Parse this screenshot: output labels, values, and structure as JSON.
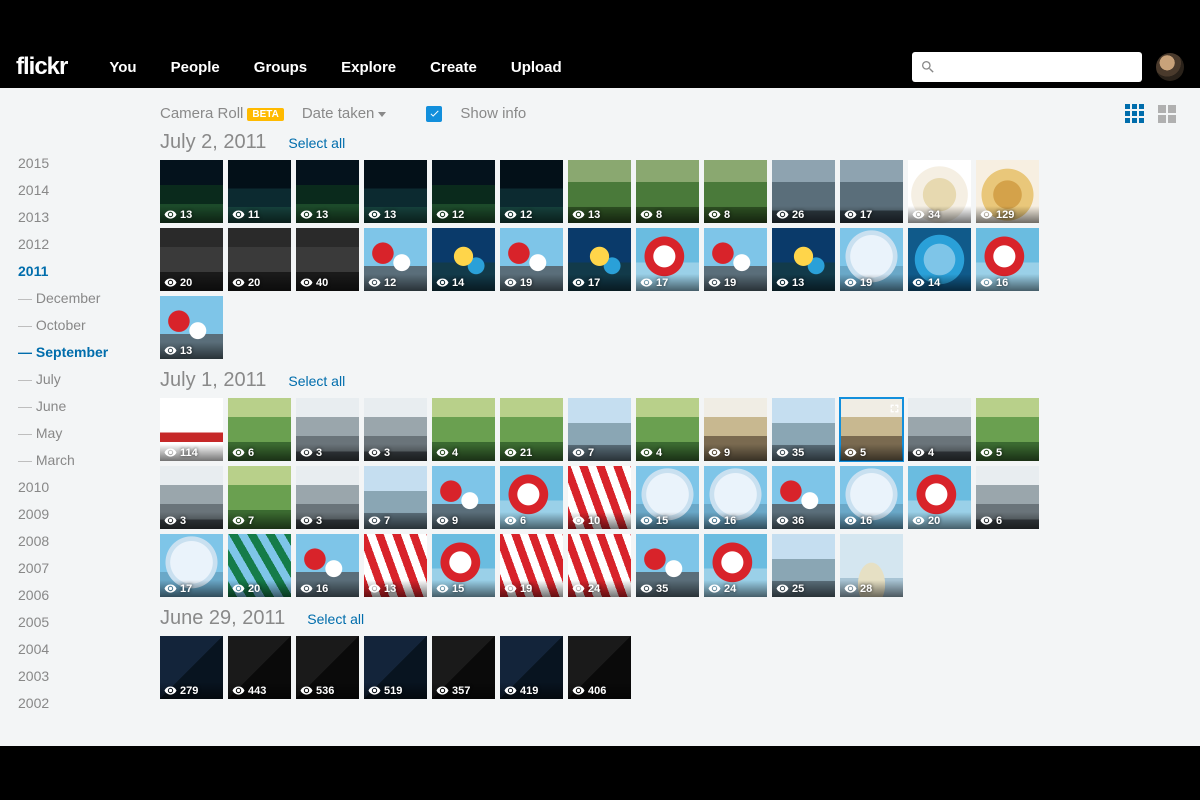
{
  "brand": "flickr",
  "nav": [
    "You",
    "People",
    "Groups",
    "Explore",
    "Create",
    "Upload"
  ],
  "toolbar": {
    "camera_roll": "Camera Roll",
    "beta": "BETA",
    "date_taken": "Date taken",
    "show_info": "Show info"
  },
  "sidebar": {
    "years_top": [
      "2015",
      "2014",
      "2013",
      "2012"
    ],
    "active_year": "2011",
    "months": [
      "December",
      "October",
      "September",
      "July",
      "June",
      "May",
      "March"
    ],
    "active_month": "September",
    "years_bottom": [
      "2010",
      "2009",
      "2008",
      "2007",
      "2006",
      "2005",
      "2004",
      "2003",
      "2002"
    ]
  },
  "select_all": "Select all",
  "groups": [
    {
      "title": "July 2, 2011",
      "thumbs": [
        {
          "v": 13,
          "p": "p-night"
        },
        {
          "v": 11,
          "p": "p-night2"
        },
        {
          "v": 13,
          "p": "p-night"
        },
        {
          "v": 13,
          "p": "p-night2"
        },
        {
          "v": 12,
          "p": "p-night"
        },
        {
          "v": 12,
          "p": "p-night2"
        },
        {
          "v": 13,
          "p": "p-green"
        },
        {
          "v": 8,
          "p": "p-green"
        },
        {
          "v": 8,
          "p": "p-green"
        },
        {
          "v": 26,
          "p": "p-street"
        },
        {
          "v": 17,
          "p": "p-street"
        },
        {
          "v": 34,
          "p": "p-food"
        },
        {
          "v": 129,
          "p": "p-food2"
        },
        {
          "v": 20,
          "p": "p-crowd"
        },
        {
          "v": 20,
          "p": "p-crowd"
        },
        {
          "v": 40,
          "p": "p-crowd"
        },
        {
          "v": 12,
          "p": "p-balloon"
        },
        {
          "v": 14,
          "p": "p-balloon2"
        },
        {
          "v": 19,
          "p": "p-balloon"
        },
        {
          "v": 17,
          "p": "p-balloon2"
        },
        {
          "v": 17,
          "p": "p-balloon3"
        },
        {
          "v": 19,
          "p": "p-balloon"
        },
        {
          "v": 13,
          "p": "p-balloon2"
        },
        {
          "v": 19,
          "p": "p-bface"
        },
        {
          "v": 14,
          "p": "p-arch"
        },
        {
          "v": 16,
          "p": "p-balloon3"
        },
        {
          "v": 13,
          "p": "p-balloon"
        }
      ]
    },
    {
      "title": "July 1, 2011",
      "thumbs": [
        {
          "v": 114,
          "p": "p-sign"
        },
        {
          "v": 6,
          "p": "p-grn2"
        },
        {
          "v": 3,
          "p": "p-city"
        },
        {
          "v": 3,
          "p": "p-city"
        },
        {
          "v": 4,
          "p": "p-grn2"
        },
        {
          "v": 21,
          "p": "p-grn2"
        },
        {
          "v": 7,
          "p": "p-sky"
        },
        {
          "v": 4,
          "p": "p-grn2"
        },
        {
          "v": 9,
          "p": "p-cityw"
        },
        {
          "v": 35,
          "p": "p-sky"
        },
        {
          "v": 5,
          "p": "p-cityw",
          "sel": true
        },
        {
          "v": 4,
          "p": "p-city"
        },
        {
          "v": 5,
          "p": "p-grn2"
        },
        {
          "v": 3,
          "p": "p-city"
        },
        {
          "v": 7,
          "p": "p-grn2"
        },
        {
          "v": 3,
          "p": "p-city"
        },
        {
          "v": 7,
          "p": "p-sky"
        },
        {
          "v": 9,
          "p": "p-balloon"
        },
        {
          "v": 6,
          "p": "p-balloon3"
        },
        {
          "v": 10,
          "p": "p-stripe"
        },
        {
          "v": 15,
          "p": "p-bface"
        },
        {
          "v": 16,
          "p": "p-bface"
        },
        {
          "v": 36,
          "p": "p-balloon"
        },
        {
          "v": 16,
          "p": "p-bface"
        },
        {
          "v": 20,
          "p": "p-balloon3"
        },
        {
          "v": 6,
          "p": "p-city"
        },
        {
          "v": 17,
          "p": "p-bface"
        },
        {
          "v": 20,
          "p": "p-stripes-green"
        },
        {
          "v": 16,
          "p": "p-balloon"
        },
        {
          "v": 13,
          "p": "p-stripe"
        },
        {
          "v": 15,
          "p": "p-balloon3"
        },
        {
          "v": 19,
          "p": "p-stripe"
        },
        {
          "v": 24,
          "p": "p-stripe"
        },
        {
          "v": 35,
          "p": "p-balloon"
        },
        {
          "v": 24,
          "p": "p-balloon3"
        },
        {
          "v": 25,
          "p": "p-sky"
        },
        {
          "v": 28,
          "p": "p-rain"
        }
      ]
    },
    {
      "title": "June 29, 2011",
      "thumbs": [
        {
          "v": 279,
          "p": "p-darkb"
        },
        {
          "v": 443,
          "p": "p-dark"
        },
        {
          "v": 536,
          "p": "p-dark"
        },
        {
          "v": 519,
          "p": "p-darkb"
        },
        {
          "v": 357,
          "p": "p-dark"
        },
        {
          "v": 419,
          "p": "p-darkb"
        },
        {
          "v": 406,
          "p": "p-dark"
        }
      ]
    }
  ]
}
